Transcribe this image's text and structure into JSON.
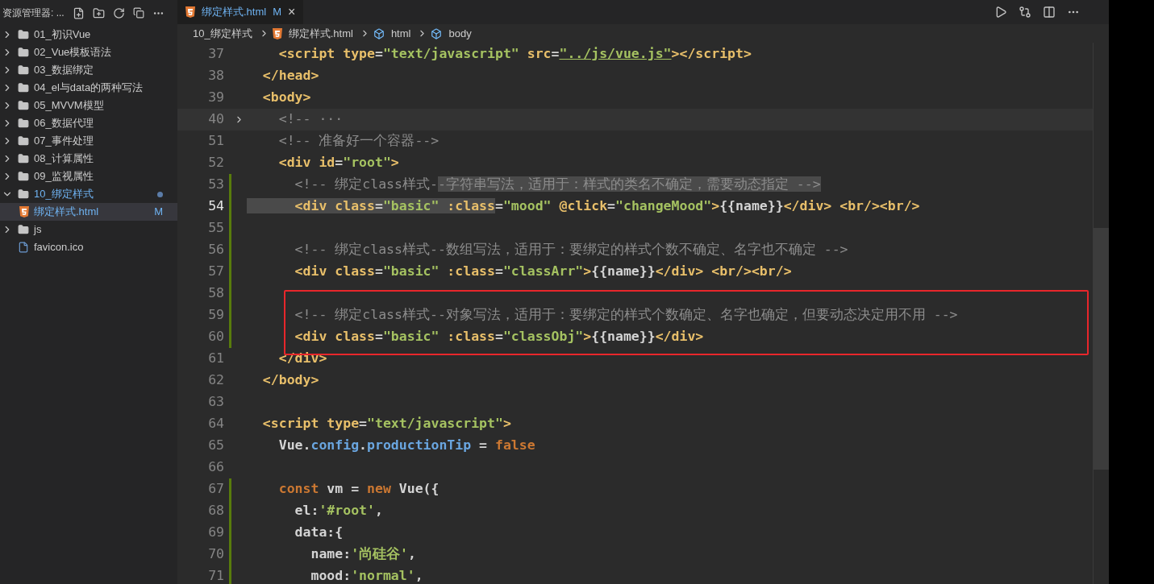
{
  "sidebar": {
    "title": "资源管理器: ...",
    "items": [
      {
        "label": "01_初识Vue",
        "kind": "folder",
        "expanded": false,
        "selected": false,
        "modified": false
      },
      {
        "label": "02_Vue模板语法",
        "kind": "folder",
        "expanded": false,
        "selected": false,
        "modified": false
      },
      {
        "label": "03_数据绑定",
        "kind": "folder",
        "expanded": false,
        "selected": false,
        "modified": false
      },
      {
        "label": "04_el与data的两种写法",
        "kind": "folder",
        "expanded": false,
        "selected": false,
        "modified": false
      },
      {
        "label": "05_MVVM模型",
        "kind": "folder",
        "expanded": false,
        "selected": false,
        "modified": false
      },
      {
        "label": "06_数据代理",
        "kind": "folder",
        "expanded": false,
        "selected": false,
        "modified": false
      },
      {
        "label": "07_事件处理",
        "kind": "folder",
        "expanded": false,
        "selected": false,
        "modified": false
      },
      {
        "label": "08_计算属性",
        "kind": "folder",
        "expanded": false,
        "selected": false,
        "modified": false
      },
      {
        "label": "09_监视属性",
        "kind": "folder",
        "expanded": false,
        "selected": false,
        "modified": false
      },
      {
        "label": "10_绑定样式",
        "kind": "folder",
        "expanded": true,
        "selected": false,
        "modified": true,
        "children": [
          {
            "label": "绑定样式.html",
            "kind": "html",
            "selected": true,
            "modified": true,
            "badge": "M"
          }
        ]
      },
      {
        "label": "js",
        "kind": "folder",
        "expanded": false,
        "selected": false,
        "modified": false
      },
      {
        "label": "favicon.ico",
        "kind": "ico",
        "selected": false,
        "modified": false
      }
    ]
  },
  "tab": {
    "label": "绑定样式.html",
    "badge": "M",
    "close": "×",
    "selected": true
  },
  "breadcrumb": [
    {
      "label": "10_绑定样式",
      "kind": "folder"
    },
    {
      "label": "绑定样式.html",
      "kind": "html"
    },
    {
      "label": "html",
      "kind": "element"
    },
    {
      "label": "body",
      "kind": "element"
    }
  ],
  "lines": [
    {
      "number": "37",
      "changed": false,
      "current": false,
      "tokens": [
        {
          "kind": "tag",
          "t": "    <script"
        },
        {
          "kind": "attr",
          "t": " type"
        },
        {
          "kind": "p",
          "t": "="
        },
        {
          "kind": "str",
          "t": "\"text/javascript\""
        },
        {
          "kind": "attr",
          "t": " src"
        },
        {
          "kind": "p",
          "t": "="
        },
        {
          "kind": "link",
          "t": "\"../js/vue.js\""
        },
        {
          "kind": "tag",
          "t": "></script>"
        }
      ]
    },
    {
      "number": "38",
      "changed": false,
      "current": false,
      "tokens": [
        {
          "kind": "tag",
          "t": "  </head>"
        }
      ]
    },
    {
      "number": "39",
      "changed": false,
      "current": false,
      "tokens": [
        {
          "kind": "tag",
          "t": "  <body>"
        }
      ]
    },
    {
      "number": "40",
      "changed": false,
      "current": false,
      "folded": true,
      "tokens": [
        {
          "kind": "cm",
          "t": "    <!-- ···"
        }
      ]
    },
    {
      "number": "51",
      "changed": false,
      "current": false,
      "tokens": [
        {
          "kind": "cm",
          "t": "    <!-- 准备好一个容器-->"
        }
      ]
    },
    {
      "number": "52",
      "changed": false,
      "current": false,
      "tokens": [
        {
          "kind": "tag",
          "t": "    <div"
        },
        {
          "kind": "attr",
          "t": " id"
        },
        {
          "kind": "p",
          "t": "="
        },
        {
          "kind": "str",
          "t": "\"root\""
        },
        {
          "kind": "tag",
          "t": ">"
        }
      ]
    },
    {
      "number": "53",
      "changed": true,
      "current": false,
      "tokens": [
        {
          "kind": "cm",
          "t": "      <!-- 绑定class样式-",
          "sel": false
        },
        {
          "kind": "cm",
          "t": "-字符串写法，适用于：样式的类名不确定，需要动态指定 -->",
          "sel": true
        }
      ]
    },
    {
      "number": "54",
      "changed": true,
      "current": true,
      "tokens": [
        {
          "kind": "tag",
          "t": "      <div",
          "sel": true
        },
        {
          "kind": "attr",
          "t": " class",
          "sel": true
        },
        {
          "kind": "p",
          "t": "=",
          "sel": true
        },
        {
          "kind": "str",
          "t": "\"basic\"",
          "sel": true
        },
        {
          "kind": "attr",
          "t": " :class",
          "sel": true
        },
        {
          "kind": "p",
          "t": "=",
          "sel": false
        },
        {
          "kind": "str",
          "t": "\"mood\""
        },
        {
          "kind": "attr",
          "t": " @click"
        },
        {
          "kind": "p",
          "t": "="
        },
        {
          "kind": "str",
          "t": "\"changeMood\""
        },
        {
          "kind": "tag",
          "t": ">"
        },
        {
          "kind": "p",
          "t": "{{name}}"
        },
        {
          "kind": "tag",
          "t": "</div>"
        },
        {
          "kind": "tag",
          "t": " <br/><br/>"
        }
      ]
    },
    {
      "number": "55",
      "changed": true,
      "current": false
    },
    {
      "number": "56",
      "changed": true,
      "current": false,
      "tokens": [
        {
          "kind": "cm",
          "t": "      <!-- 绑定class样式--数组写法，适用于：要绑定的样式个数不确定、名字也不确定 -->"
        }
      ]
    },
    {
      "number": "57",
      "changed": true,
      "current": false,
      "tokens": [
        {
          "kind": "tag",
          "t": "      <div"
        },
        {
          "kind": "attr",
          "t": " class"
        },
        {
          "kind": "p",
          "t": "="
        },
        {
          "kind": "str",
          "t": "\"basic\""
        },
        {
          "kind": "attr",
          "t": " :class"
        },
        {
          "kind": "p",
          "t": "="
        },
        {
          "kind": "str",
          "t": "\"classArr\""
        },
        {
          "kind": "tag",
          "t": ">"
        },
        {
          "kind": "p",
          "t": "{{name}}"
        },
        {
          "kind": "tag",
          "t": "</div>"
        },
        {
          "kind": "tag",
          "t": " <br/><br/>"
        }
      ]
    },
    {
      "number": "58",
      "changed": true,
      "current": false,
      "boxed": true
    },
    {
      "number": "59",
      "changed": true,
      "current": false,
      "boxed": true,
      "tokens": [
        {
          "kind": "cm",
          "t": "      <!-- 绑定class样式--对象写法，适用于：要绑定的样式个数确定、名字也确定，但要动态决定用不用 -->"
        }
      ]
    },
    {
      "number": "60",
      "changed": true,
      "current": false,
      "boxed": true,
      "tokens": [
        {
          "kind": "tag",
          "t": "      <div"
        },
        {
          "kind": "attr",
          "t": " class"
        },
        {
          "kind": "p",
          "t": "="
        },
        {
          "kind": "str",
          "t": "\"basic\""
        },
        {
          "kind": "attr",
          "t": " :class"
        },
        {
          "kind": "p",
          "t": "="
        },
        {
          "kind": "str",
          "t": "\"classObj\""
        },
        {
          "kind": "tag",
          "t": ">"
        },
        {
          "kind": "p",
          "t": "{{name}}"
        },
        {
          "kind": "tag",
          "t": "</div>"
        }
      ]
    },
    {
      "number": "61",
      "changed": false,
      "current": false,
      "tokens": [
        {
          "kind": "tag",
          "t": "    </div>"
        }
      ]
    },
    {
      "number": "62",
      "changed": false,
      "current": false,
      "tokens": [
        {
          "kind": "tag",
          "t": "  </body>"
        }
      ]
    },
    {
      "number": "63",
      "changed": false,
      "current": false
    },
    {
      "number": "64",
      "changed": false,
      "current": false,
      "tokens": [
        {
          "kind": "tag",
          "t": "  <script"
        },
        {
          "kind": "attr",
          "t": " type"
        },
        {
          "kind": "p",
          "t": "="
        },
        {
          "kind": "str",
          "t": "\"text/javascript\""
        },
        {
          "kind": "tag",
          "t": ">"
        }
      ]
    },
    {
      "number": "65",
      "changed": false,
      "current": false,
      "tokens": [
        {
          "kind": "p",
          "t": "    Vue."
        },
        {
          "kind": "prop",
          "t": "config"
        },
        {
          "kind": "p",
          "t": "."
        },
        {
          "kind": "prop",
          "t": "productionTip"
        },
        {
          "kind": "p",
          "t": " = "
        },
        {
          "kind": "kw",
          "t": "false"
        }
      ]
    },
    {
      "number": "66",
      "changed": false,
      "current": false
    },
    {
      "number": "67",
      "changed": true,
      "current": false,
      "tokens": [
        {
          "kind": "kw",
          "t": "    const"
        },
        {
          "kind": "p",
          "t": " vm = "
        },
        {
          "kind": "kw",
          "t": "new"
        },
        {
          "kind": "p",
          "t": " Vue({"
        }
      ]
    },
    {
      "number": "68",
      "changed": true,
      "current": false,
      "tokens": [
        {
          "kind": "p",
          "t": "      el:"
        },
        {
          "kind": "str",
          "t": "'#root'"
        },
        {
          "kind": "p",
          "t": ","
        }
      ]
    },
    {
      "number": "69",
      "changed": true,
      "current": false,
      "tokens": [
        {
          "kind": "p",
          "t": "      data:{"
        }
      ]
    },
    {
      "number": "70",
      "changed": true,
      "current": false,
      "tokens": [
        {
          "kind": "p",
          "t": "        name:"
        },
        {
          "kind": "str",
          "t": "'尚硅谷'"
        },
        {
          "kind": "p",
          "t": ","
        }
      ]
    },
    {
      "number": "71",
      "changed": true,
      "current": false,
      "tokens": [
        {
          "kind": "p",
          "t": "        mood:"
        },
        {
          "kind": "str",
          "t": "'normal'"
        },
        {
          "kind": "p",
          "t": ","
        }
      ]
    }
  ]
}
